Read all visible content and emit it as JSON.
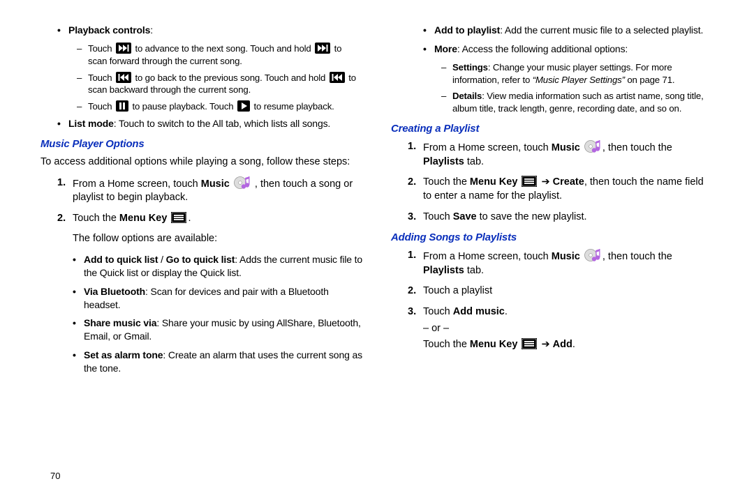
{
  "page_number": "70",
  "left": {
    "playback_label": "Playback controls",
    "pb1a": "Touch ",
    "pb1b": " to advance to the next song. Touch and hold ",
    "pb1c": " to scan forward through the current song.",
    "pb2a": "Touch ",
    "pb2b": " to go back to the previous song. Touch and hold ",
    "pb2c": " to scan backward through the current song.",
    "pb3a": "Touch ",
    "pb3b": " to pause playback. Touch ",
    "pb3c": " to resume playback.",
    "list_mode_lbl": "List mode",
    "list_mode_txt": ": Touch to switch to the All tab, which lists all songs.",
    "h_options": "Music Player Options",
    "intro": "To access additional options while playing a song, follow these steps:",
    "s1_n": "1.",
    "s1a": "From a Home screen, touch ",
    "s1_music": "Music",
    "s1b": ", then touch a song or playlist to begin playback.",
    "s2_n": "2.",
    "s2a": "Touch the ",
    "s2_mk": "Menu Key",
    "s2b": ".",
    "follow": "The follow options are available:",
    "o1_lbl": "Add to quick list",
    "o1_sep": " / ",
    "o1_lbl2": "Go to quick list",
    "o1_txt": ": Adds the current music file to the Quick list or display the Quick list.",
    "o2_lbl": "Via Bluetooth",
    "o2_txt": ": Scan for devices and pair with a Bluetooth headset.",
    "o3_lbl": "Share music via",
    "o3_txt": ": Share your music by using AllShare, Bluetooth, Email, or Gmail.",
    "o4_lbl": "Set as alarm tone",
    "o4_txt": ": Create an alarm that uses the current song as the tone."
  },
  "right": {
    "r1_lbl": "Add to playlist",
    "r1_txt": ": Add the current music file to a selected playlist.",
    "r2_lbl": "More",
    "r2_txt": ": Access the following additional options:",
    "r2a_lbl": "Settings",
    "r2a_txt": ": Change your music player settings. For more information, refer to ",
    "r2a_ref": "“Music Player Settings” ",
    "r2a_pg": " on page 71.",
    "r2b_lbl": "Details",
    "r2b_txt": ": View media information such as artist name, song title, album title, track length, genre, recording date, and so on.",
    "h_create": "Creating a Playlist",
    "c1_n": "1.",
    "c1a": "From a Home screen, touch ",
    "c1_music": "Music",
    "c1b": ", then touch the ",
    "c1_tab": "Playlists",
    "c1c": " tab.",
    "c2_n": "2.",
    "c2a": "Touch the ",
    "c2_mk": "Menu Key",
    "c2arrow": " ➔ ",
    "c2_create": "Create",
    "c2b": ", then touch the name field to enter a name for the playlist.",
    "c3_n": "3.",
    "c3a": "Touch ",
    "c3_save": "Save",
    "c3b": " to save the new playlist.",
    "h_add": "Adding Songs to Playlists",
    "a1_n": "1.",
    "a1a": "From a Home screen, touch ",
    "a1_music": "Music",
    "a1b": ", then touch the ",
    "a1_tab": "Playlists",
    "a1c": " tab.",
    "a2_n": "2.",
    "a2txt": "Touch a playlist",
    "a3_n": "3.",
    "a3a": "Touch ",
    "a3_addm": "Add music",
    "a3b": ".",
    "or": "– or –",
    "a3c": "Touch the ",
    "a3_mk": "Menu Key",
    "a3arrow": " ➔ ",
    "a3_add": "Add",
    "a3d": "."
  }
}
